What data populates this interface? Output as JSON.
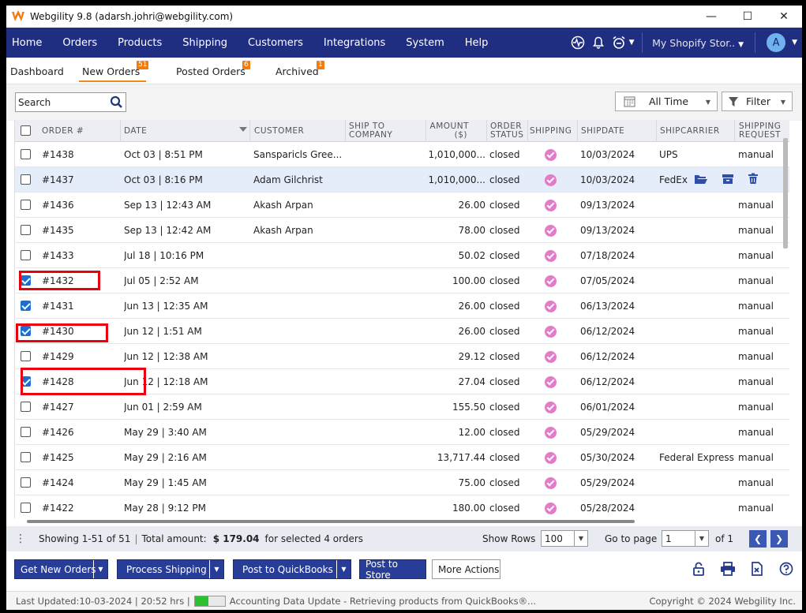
{
  "window": {
    "title": "Webgility 9.8 (adarsh.johri@webgility.com)",
    "controls": [
      "minimize",
      "maximize",
      "close"
    ]
  },
  "nav": {
    "items": [
      "Home",
      "Orders",
      "Products",
      "Shipping",
      "Customers",
      "Integrations",
      "System",
      "Help"
    ],
    "store": "My Shopify Stor..",
    "avatar": "A"
  },
  "tabs": [
    {
      "label": "Dashboard",
      "badge": "",
      "active": false
    },
    {
      "label": "New Orders",
      "badge": "51",
      "active": true
    },
    {
      "label": "Posted Orders",
      "badge": "6",
      "active": false
    },
    {
      "label": "Archived",
      "badge": "1",
      "active": false
    }
  ],
  "toolbar": {
    "search_placeholder": "Search",
    "time_filter": "All Time",
    "filter_label": "Filter"
  },
  "table": {
    "headers": {
      "order": "ORDER #",
      "date": "DATE",
      "customer": "CUSTOMER",
      "ship_to_line1": "SHIP TO",
      "ship_to_line2": "COMPANY",
      "amount_line1": "AMOUNT",
      "amount_line2": "($)",
      "status_line1": "ORDER",
      "status_line2": "STATUS",
      "shipping": "SHIPPING",
      "shipdate": "SHIPDATE",
      "carrier": "SHIPCARRIER",
      "request_line1": "SHIPPING",
      "request_line2": "REQUEST"
    },
    "rows": [
      {
        "order": "#1438",
        "date": "Oct 03 | 8:51 PM",
        "customer": "Sansparicls Gree...",
        "amount": "1,010,000...",
        "status": "closed",
        "shipdate": "10/03/2024",
        "carrier": "UPS",
        "request": "manual",
        "checked": false
      },
      {
        "order": "#1437",
        "date": "Oct 03 | 8:16 PM",
        "customer": "Adam Gilchrist",
        "amount": "1,010,000...",
        "status": "closed",
        "shipdate": "10/03/2024",
        "carrier": "FedEx",
        "request": "",
        "checked": false
      },
      {
        "order": "#1436",
        "date": "Sep 13 | 12:43 AM",
        "customer": "Akash Arpan",
        "amount": "26.00",
        "status": "closed",
        "shipdate": "09/13/2024",
        "carrier": "",
        "request": "manual",
        "checked": false
      },
      {
        "order": "#1435",
        "date": "Sep 13 | 12:42 AM",
        "customer": "Akash Arpan",
        "amount": "78.00",
        "status": "closed",
        "shipdate": "09/13/2024",
        "carrier": "",
        "request": "manual",
        "checked": false
      },
      {
        "order": "#1433",
        "date": "Jul 18 | 10:16 PM",
        "customer": "",
        "amount": "50.02",
        "status": "closed",
        "shipdate": "07/18/2024",
        "carrier": "",
        "request": "manual",
        "checked": false
      },
      {
        "order": "#1432",
        "date": "Jul 05 | 2:52 AM",
        "customer": "",
        "amount": "100.00",
        "status": "closed",
        "shipdate": "07/05/2024",
        "carrier": "",
        "request": "manual",
        "checked": true
      },
      {
        "order": "#1431",
        "date": "Jun 13 | 12:35 AM",
        "customer": "",
        "amount": "26.00",
        "status": "closed",
        "shipdate": "06/13/2024",
        "carrier": "",
        "request": "manual",
        "checked": true
      },
      {
        "order": "#1430",
        "date": "Jun 12 | 1:51 AM",
        "customer": "",
        "amount": "26.00",
        "status": "closed",
        "shipdate": "06/12/2024",
        "carrier": "",
        "request": "manual",
        "checked": true
      },
      {
        "order": "#1429",
        "date": "Jun 12 | 12:38 AM",
        "customer": "",
        "amount": "29.12",
        "status": "closed",
        "shipdate": "06/12/2024",
        "carrier": "",
        "request": "manual",
        "checked": false
      },
      {
        "order": "#1428",
        "date": "Jun 12 | 12:18 AM",
        "customer": "",
        "amount": "27.04",
        "status": "closed",
        "shipdate": "06/12/2024",
        "carrier": "",
        "request": "manual",
        "checked": true
      },
      {
        "order": "#1427",
        "date": "Jun 01 | 2:59 AM",
        "customer": "",
        "amount": "155.50",
        "status": "closed",
        "shipdate": "06/01/2024",
        "carrier": "",
        "request": "manual",
        "checked": false
      },
      {
        "order": "#1426",
        "date": "May 29 | 3:40 AM",
        "customer": "",
        "amount": "12.00",
        "status": "closed",
        "shipdate": "05/29/2024",
        "carrier": "",
        "request": "manual",
        "checked": false
      },
      {
        "order": "#1425",
        "date": "May 29 | 2:16 AM",
        "customer": "",
        "amount": "13,717.44",
        "status": "closed",
        "shipdate": "05/30/2024",
        "carrier": "Federal Express",
        "request": "manual",
        "checked": false
      },
      {
        "order": "#1424",
        "date": "May 29 | 1:45 AM",
        "customer": "",
        "amount": "75.00",
        "status": "closed",
        "shipdate": "05/29/2024",
        "carrier": "",
        "request": "manual",
        "checked": false
      },
      {
        "order": "#1422",
        "date": "May 28 | 9:12 PM",
        "customer": "",
        "amount": "180.00",
        "status": "closed",
        "shipdate": "05/28/2024",
        "carrier": "",
        "request": "manual",
        "checked": false
      }
    ]
  },
  "summary": {
    "showing": "Showing 1-51 of 51",
    "total_label": "Total amount:",
    "total_value": "$ 179.04",
    "selected_text": "for selected 4 orders",
    "show_rows_label": "Show Rows",
    "show_rows_value": "100",
    "goto_label": "Go to page",
    "page_value": "1",
    "of_label": "of 1"
  },
  "actions": {
    "get_new_orders": "Get New Orders",
    "process_shipping": "Process Shipping",
    "post_quickbooks": "Post to QuickBooks",
    "post_store": "Post to Store",
    "more_actions": "More Actions"
  },
  "status": {
    "last_updated": "Last Updated:10-03-2024 | 20:52 hrs |",
    "progress": 0.45,
    "message": "Accounting Data Update - Retrieving products from QuickBooks®...",
    "copyright": "Copyright © 2024 Webgility Inc."
  },
  "colors": {
    "nav_bg": "#1f2e80",
    "accent_orange": "#f07c12",
    "shipping_dot": "#e47ac9",
    "highlight_box": "#e8000f"
  }
}
